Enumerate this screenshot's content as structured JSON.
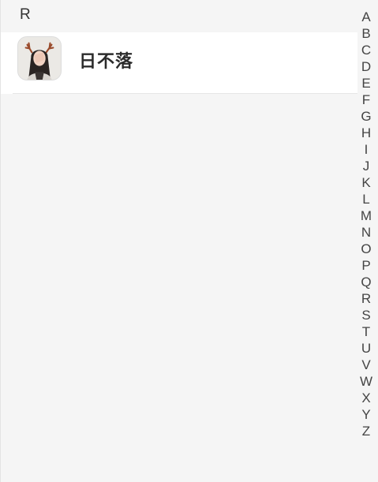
{
  "section": {
    "header": "R"
  },
  "contacts": [
    {
      "name": "日不落",
      "avatar": "avatar-photo"
    }
  ],
  "index_bar": {
    "letters": [
      "A",
      "B",
      "C",
      "D",
      "E",
      "F",
      "G",
      "H",
      "I",
      "J",
      "K",
      "L",
      "M",
      "N",
      "O",
      "P",
      "Q",
      "R",
      "S",
      "T",
      "U",
      "V",
      "W",
      "X",
      "Y",
      "Z"
    ]
  }
}
